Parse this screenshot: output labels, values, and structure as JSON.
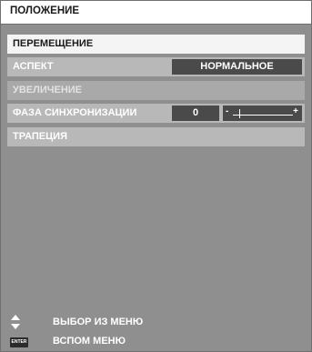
{
  "menu": {
    "title": "ПОЛОЖЕНИЕ",
    "items": [
      {
        "label": "ПЕРЕМЕЩЕНИЕ"
      },
      {
        "label": "АСПЕКТ",
        "value": "НОРМАЛЬНОЕ"
      },
      {
        "label": "УВЕЛИЧЕНИЕ"
      },
      {
        "label": "ФАЗА СИНХРОНИЗАЦИИ",
        "value": "0",
        "slider_minus": "-",
        "slider_plus": "+",
        "slider_level": 0.1
      },
      {
        "label": "ТРАПЕЦИЯ"
      }
    ]
  },
  "footer": {
    "select_hint": "ВЫБОР ИЗ МЕНЮ",
    "enter_key": "ENTER",
    "submenu_hint": "ВСПОМ МЕНЮ"
  },
  "colors": {
    "panel_bg": "#8f8f8f",
    "highlight": "#f4f4f4",
    "value_box": "#4a4a4a"
  }
}
